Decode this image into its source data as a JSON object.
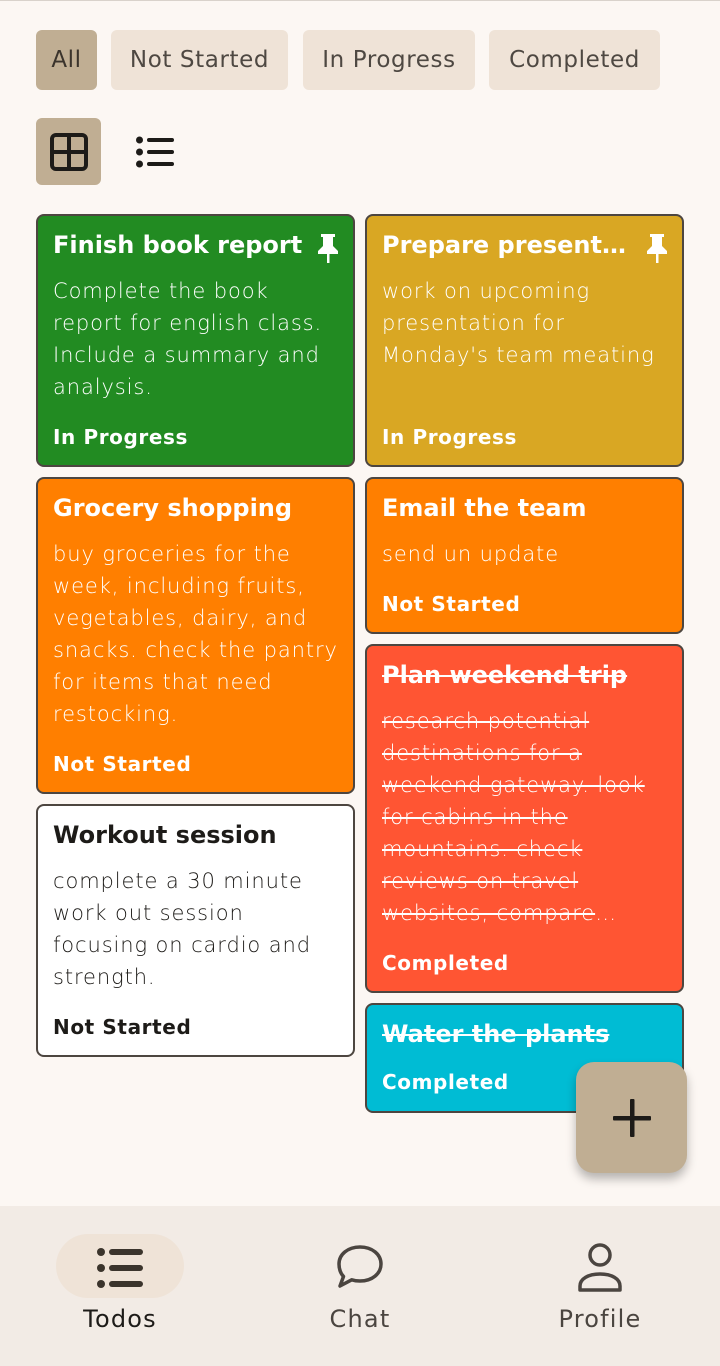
{
  "filters": [
    {
      "label": "All",
      "active": true
    },
    {
      "label": "Not Started",
      "active": false
    },
    {
      "label": "In Progress",
      "active": false
    },
    {
      "label": "Completed",
      "active": false
    }
  ],
  "view_toggle": {
    "grid_icon": "grid-view-icon",
    "list_icon": "list-view-icon",
    "active": "grid"
  },
  "todos": [
    {
      "title": "Finish book report",
      "description": "Complete the book report for english class. Include a summary and analysis.",
      "status": "In Progress",
      "pinned": true,
      "color": "#228b22",
      "completed": false
    },
    {
      "title": "Prepare presentation",
      "description": "work on upcoming presentation for Monday's team meating",
      "status": "In Progress",
      "pinned": true,
      "color": "#d9a723",
      "completed": false
    },
    {
      "title": "Grocery shopping",
      "description": "buy groceries for the week, including fruits, vegetables, dairy, and snacks. check the pantry for items that need restocking.",
      "status": "Not Started",
      "pinned": false,
      "color": "#ff7f00",
      "completed": false
    },
    {
      "title": "Email the team",
      "description": "send un update",
      "status": "Not Started",
      "pinned": false,
      "color": "#ff7f00",
      "completed": false
    },
    {
      "title": "Plan weekend trip",
      "description": "research potential destinations for a weekend gateway. look for cabins in the mountains. check reviews on travel websites, compare prices and book",
      "status": "Completed",
      "pinned": false,
      "color": "#ff5533",
      "completed": true
    },
    {
      "title": "Workout session",
      "description": "complete a 30 minute work out session focusing on cardio and strength.",
      "status": "Not Started",
      "pinned": false,
      "color": "#ffffff",
      "completed": false
    },
    {
      "title": "Water the plants",
      "description": "",
      "status": "Completed",
      "pinned": false,
      "color": "#00bcd4",
      "completed": true
    }
  ],
  "fab": {
    "icon": "plus-icon"
  },
  "bottom_nav": [
    {
      "label": "Todos",
      "icon": "list-icon",
      "active": true
    },
    {
      "label": "Chat",
      "icon": "chat-bubble-icon",
      "active": false
    },
    {
      "label": "Profile",
      "icon": "person-icon",
      "active": false
    }
  ]
}
